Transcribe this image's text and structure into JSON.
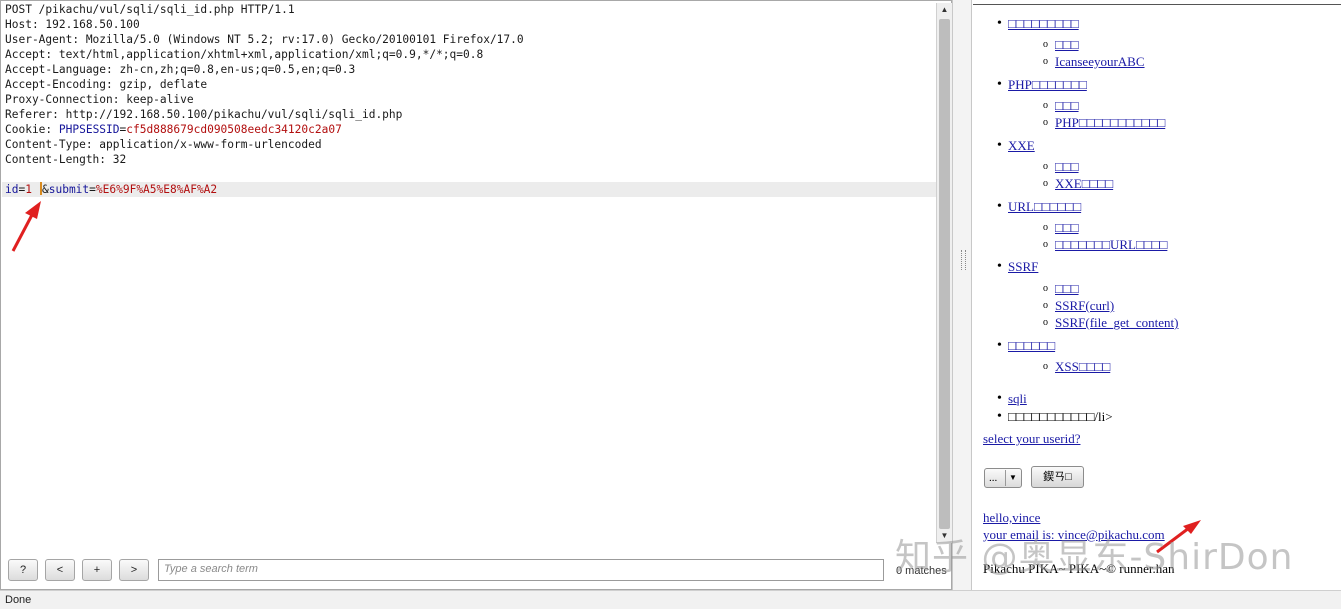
{
  "request": {
    "lines": [
      "POST /pikachu/vul/sqli/sqli_id.php HTTP/1.1",
      "Host: 192.168.50.100",
      "User-Agent: Mozilla/5.0 (Windows NT 5.2; rv:17.0) Gecko/20100101 Firefox/17.0",
      "Accept: text/html,application/xhtml+xml,application/xml;q=0.9,*/*;q=0.8",
      "Accept-Language: zh-cn,zh;q=0.8,en-us;q=0.5,en;q=0.3",
      "Accept-Encoding: gzip, deflate",
      "Proxy-Connection: keep-alive",
      "Referer: http://192.168.50.100/pikachu/vul/sqli/sqli_id.php"
    ],
    "cookie_label": "Cookie: ",
    "cookie_name": "PHPSESSID",
    "cookie_eq": "=",
    "cookie_value": "cf5d888679cd090508eedc34120c2a07",
    "content_type": "Content-Type: application/x-www-form-urlencoded",
    "content_length": "Content-Length: 32",
    "body": {
      "p1_name": "id",
      "eq1": "=",
      "p1_value": "1",
      "amp": "&",
      "p2_name": "submit",
      "eq2": "=",
      "p2_value": "%E6%9F%A5%E8%AF%A2"
    }
  },
  "toolbar": {
    "help": "?",
    "prev": "<",
    "add": "+",
    "next": ">",
    "search_placeholder": "Type a search term",
    "matches": "0 matches"
  },
  "status": "Done",
  "page": {
    "items": [
      {
        "label": "□□□□□□□□□",
        "subs": [
          "□□□",
          "IcanseeyourABC"
        ]
      },
      {
        "label": "PHP□□□□□□□",
        "subs": [
          "□□□",
          "PHP□□□□□□□□□□□"
        ]
      },
      {
        "label": "XXE",
        "subs": [
          "□□□",
          "XXE□□□□"
        ]
      },
      {
        "label": "URL□□□□□□",
        "subs": [
          "□□□",
          "□□□□□□□URL□□□□"
        ]
      },
      {
        "label": "SSRF",
        "subs": [
          "□□□",
          "SSRF(curl)",
          "SSRF(file_get_content)"
        ]
      },
      {
        "label": "□□□□□□",
        "subs": [
          "XSS□□□□"
        ]
      }
    ],
    "sqli": "sqli",
    "broken_item": "□□□□□□□□□□□/li>",
    "select_prompt": "select your userid?",
    "select_value": "...",
    "submit_label": "鍥ㄢ□",
    "hello": "hello,vince",
    "email": "your email is: vince@pikachu.com",
    "footer": "Pikachu PIKA~ PIKA~© runner.han"
  },
  "watermark": "知乎 @奥显东-ShirDon"
}
